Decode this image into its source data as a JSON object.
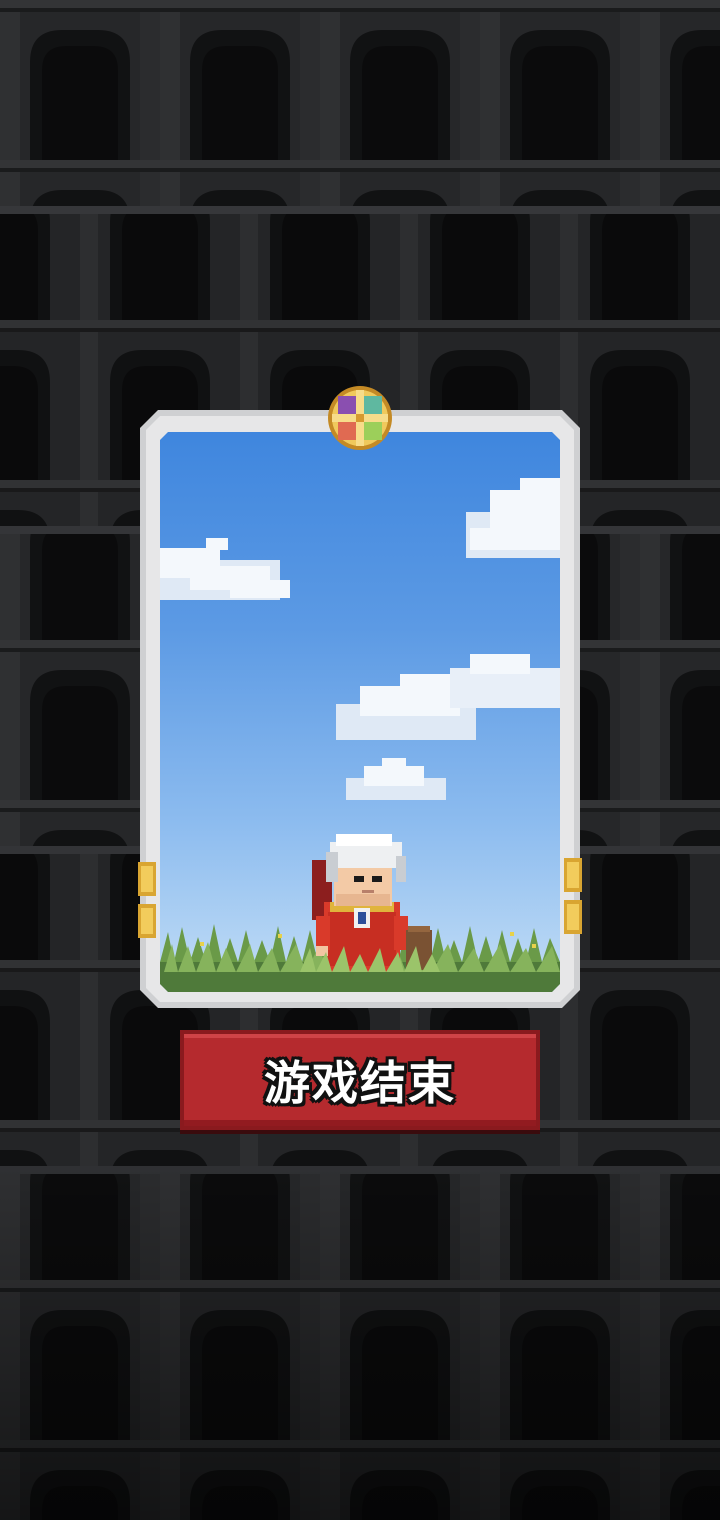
{
  "screen": {
    "name": "game-over-screen"
  },
  "card": {
    "emblem_icon": "four-color-cross-emblem-icon",
    "character_icon": "white-haired-old-man-in-red-robe-icon",
    "scene": "sky-clouds-grass"
  },
  "button": {
    "label": "游戏结束"
  },
  "colors": {
    "button_red": "#b52a2e",
    "frame_silver": "#cfd0d2",
    "sky_top": "#3f86de",
    "sky_bottom": "#c3def6",
    "wall_dark": "#1d1e1f",
    "emblem_gold": "#e5b84a"
  }
}
